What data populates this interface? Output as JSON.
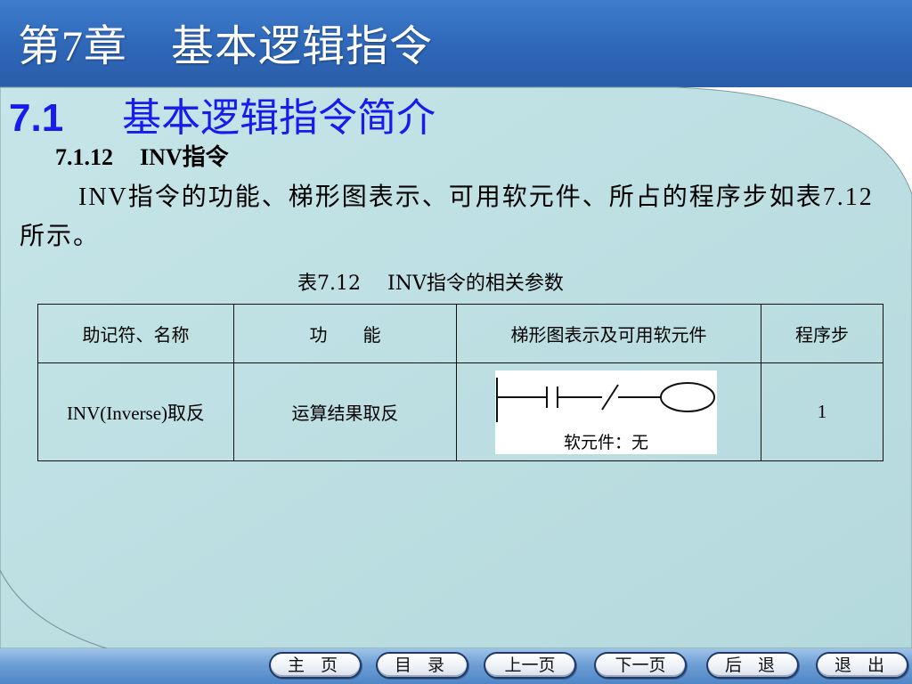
{
  "header": {
    "chapter_title": "第7章　基本逻辑指令"
  },
  "section": {
    "number": "7.1",
    "title": "基本逻辑指令简介"
  },
  "subsection": {
    "number": "7.1.12",
    "title": "INV指令"
  },
  "paragraph": {
    "text": "INV指令的功能、梯形图表示、可用软元件、所占的程序步如表7.12所示。"
  },
  "table": {
    "caption_number": "表7.12",
    "caption_title": "INV指令的相关参数",
    "headers": [
      "助记符、名称",
      "功　　能",
      "梯形图表示及可用软元件",
      "程序步"
    ],
    "row": {
      "mnemonic": "INV(Inverse)取反",
      "function": "运算结果取反",
      "ladder_note": "软元件：无",
      "steps": "1"
    }
  },
  "nav": {
    "home": "主 页",
    "contents": "目 录",
    "prev": "上一页",
    "next": "下一页",
    "back": "后 退",
    "exit": "退 出"
  },
  "colors": {
    "header_blue": "#2e66b8",
    "panel_teal": "#bcdfe2",
    "section_blue": "#1a1aee"
  }
}
